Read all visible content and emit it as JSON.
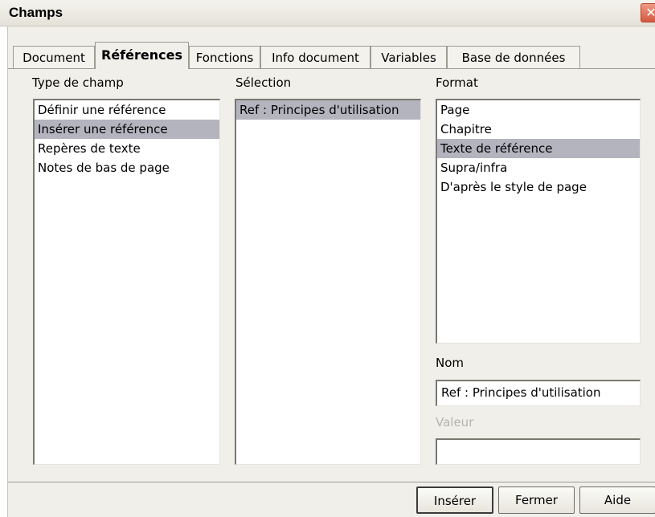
{
  "window": {
    "title": "Champs",
    "close_glyph": "✕"
  },
  "tabs": [
    {
      "label": "Document",
      "active": false
    },
    {
      "label": "Références",
      "active": true
    },
    {
      "label": "Fonctions",
      "active": false
    },
    {
      "label": "Info document",
      "active": false
    },
    {
      "label": "Variables",
      "active": false
    },
    {
      "label": "Base de données",
      "active": false
    }
  ],
  "type_de_champ": {
    "label": "Type de champ",
    "items": [
      "Définir une référence",
      "Insérer une référence",
      "Repères de texte",
      "Notes de bas de page"
    ],
    "selected_index": 1
  },
  "selection": {
    "label": "Sélection",
    "items": [
      "Ref : Principes d'utilisation"
    ],
    "selected_index": 0
  },
  "format": {
    "label": "Format",
    "items": [
      "Page",
      "Chapitre",
      "Texte de référence",
      "Supra/infra",
      "D'après le style de page"
    ],
    "selected_index": 2
  },
  "nom": {
    "label": "Nom",
    "value": "Ref : Principes d'utilisation"
  },
  "valeur": {
    "label": "Valeur",
    "value": ""
  },
  "buttons": {
    "insert": "Insérer",
    "close": "Fermer",
    "help": "Aide"
  },
  "colors": {
    "selection_highlight": "#b4b4bf",
    "dialog_bg": "#f0efe9"
  }
}
